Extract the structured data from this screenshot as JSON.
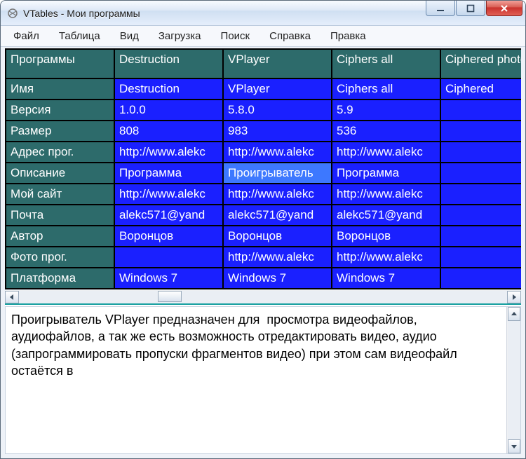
{
  "window": {
    "title": "VTables - Мои программы"
  },
  "menu": {
    "items": [
      "Файл",
      "Таблица",
      "Вид",
      "Загрузка",
      "Поиск",
      "Справка",
      "Правка"
    ]
  },
  "grid": {
    "top_left": "Программы",
    "columns": [
      "Destruction",
      "VPlayer",
      "Ciphers all",
      "Ciphered photos"
    ],
    "row_labels": [
      "Имя",
      "Версия",
      "Размер",
      "Адрес прог.",
      "Описание",
      "Мой сайт",
      "Почта",
      "Автор",
      "Фото прог.",
      "Платформа"
    ],
    "rows": [
      [
        "Destruction",
        "VPlayer",
        "Ciphers all",
        "Ciphered"
      ],
      [
        "1.0.0",
        "5.8.0",
        "5.9",
        ""
      ],
      [
        "808",
        "983",
        "536",
        ""
      ],
      [
        "http://www.alekc",
        "http://www.alekc",
        "http://www.alekc",
        ""
      ],
      [
        "Программа",
        "Проигрыватель",
        "Программа",
        ""
      ],
      [
        "http://www.alekc",
        "http://www.alekc",
        "http://www.alekc",
        ""
      ],
      [
        "alekc571@yand",
        "alekc571@yand",
        "alekc571@yand",
        ""
      ],
      [
        "Воронцов",
        "Воронцов",
        "Воронцов",
        ""
      ],
      [
        "",
        "http://www.alekc",
        "http://www.alekc",
        ""
      ],
      [
        "Windows 7",
        "Windows 7",
        "Windows 7",
        ""
      ]
    ],
    "selected": {
      "row": 4,
      "col": 1
    }
  },
  "description": "Проигрыватель VPlayer предназначен для  просмотра видеофайлов, аудиофайлов, а так же есть возможность отредактировать видео, аудио (запрограммировать пропуски фрагментов видео) при этом сам видеофайл остаётся в",
  "colors": {
    "header_bg": "#2d6b6b",
    "data_bg": "#1a20ff",
    "selected_bg": "#3d78ff"
  }
}
